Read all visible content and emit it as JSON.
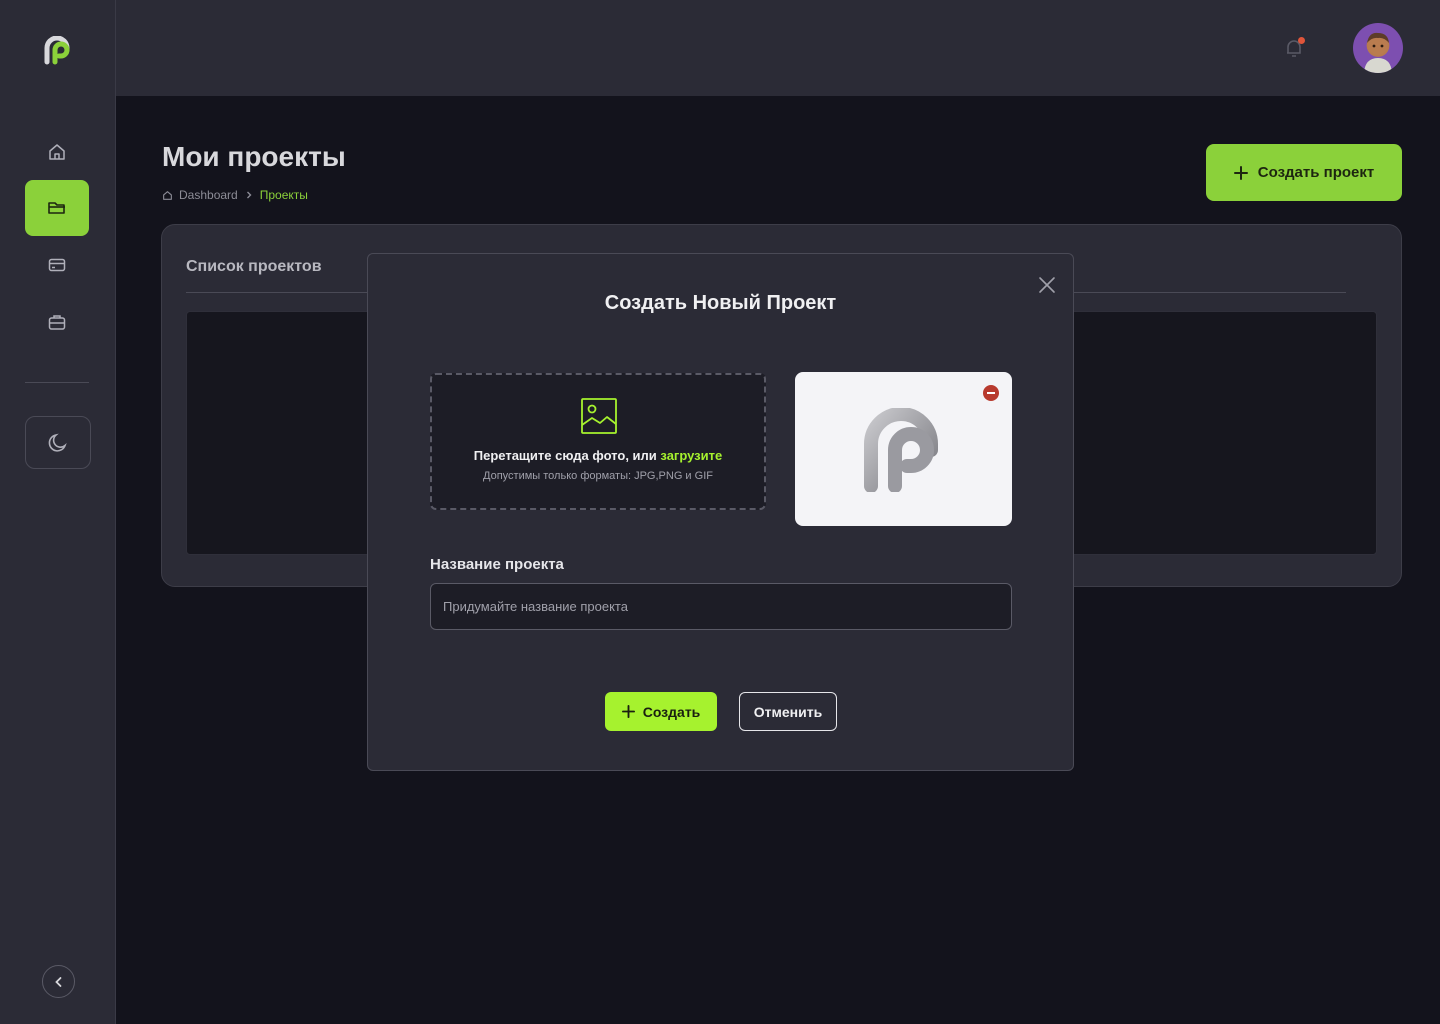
{
  "colors": {
    "accent": "#8bd13a",
    "accent_bright": "#a6f22e",
    "sidebar_bg": "#2b2b36",
    "page_bg": "#13131c",
    "danger": "#b83a2e",
    "notification_dot": "#e0553a"
  },
  "sidebar": {
    "logo_icon": "brand-logo-icon",
    "items": [
      {
        "icon": "home-icon",
        "active": false
      },
      {
        "icon": "folder-icon",
        "active": true
      },
      {
        "icon": "credit-card-icon",
        "active": false
      },
      {
        "icon": "briefcase-icon",
        "active": false
      }
    ],
    "theme_toggle_icon": "moon-icon",
    "collapse_icon": "chevron-left-icon"
  },
  "header": {
    "notification_icon": "bell-icon",
    "has_unread_notifications": true,
    "avatar_icon": "user-avatar"
  },
  "page": {
    "title": "Мои проекты",
    "breadcrumb": {
      "home_icon": "home-icon",
      "items": [
        "Dashboard",
        "Проекты"
      ]
    },
    "create_button": "Создать проект",
    "panel_title": "Список проектов"
  },
  "modal": {
    "title": "Создать Новый Проект",
    "dropzone": {
      "icon": "image-icon",
      "text": "Перетащите сюда фото, или ",
      "link": "загрузите",
      "hint": "Допустимы только форматы: JPG,PNG и GIF"
    },
    "preview": {
      "icon": "brand-logo-icon",
      "remove_icon": "remove-icon"
    },
    "name_label": "Название проекта",
    "name_placeholder": "Придумайте название проекта",
    "name_value": "",
    "submit_button": "Создать",
    "cancel_button": "Отменить"
  }
}
